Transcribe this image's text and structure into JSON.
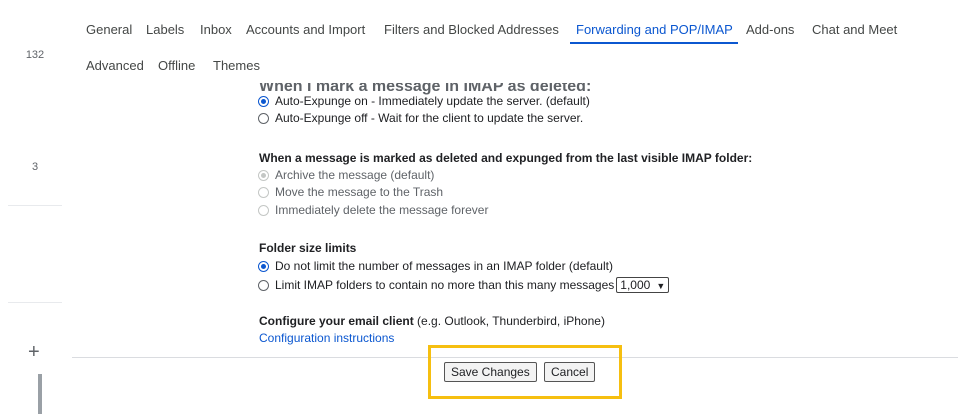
{
  "sidebar": {
    "counts": [
      "132",
      "3"
    ],
    "compose_plus": "+"
  },
  "tabs": [
    {
      "label": "General",
      "active": false
    },
    {
      "label": "Labels",
      "active": false
    },
    {
      "label": "Inbox",
      "active": false
    },
    {
      "label": "Accounts and Import",
      "active": false
    },
    {
      "label": "Filters and Blocked Addresses",
      "active": false
    },
    {
      "label": "Forwarding and POP/IMAP",
      "active": true
    },
    {
      "label": "Add-ons",
      "active": false
    },
    {
      "label": "Chat and Meet",
      "active": false
    },
    {
      "label": "Advanced",
      "active": false
    },
    {
      "label": "Offline",
      "active": false
    },
    {
      "label": "Themes",
      "active": false
    }
  ],
  "expunge": {
    "heading": "When I mark a message in IMAP as deleted:",
    "options": [
      {
        "label": "Auto-Expunge on - Immediately update the server. (default)",
        "selected": true,
        "disabled": false
      },
      {
        "label": "Auto-Expunge off - Wait for the client to update the server.",
        "selected": false,
        "disabled": false
      }
    ]
  },
  "deleted": {
    "heading": "When a message is marked as deleted and expunged from the last visible IMAP folder:",
    "options": [
      {
        "label": "Archive the message (default)",
        "selected": true,
        "disabled": true
      },
      {
        "label": "Move the message to the Trash",
        "selected": false,
        "disabled": true
      },
      {
        "label": "Immediately delete the message forever",
        "selected": false,
        "disabled": true
      }
    ]
  },
  "folder_limits": {
    "heading": "Folder size limits",
    "options": [
      {
        "label": "Do not limit the number of messages in an IMAP folder (default)",
        "selected": true
      },
      {
        "label": "Limit IMAP folders to contain no more than this many messages",
        "selected": false
      }
    ],
    "limit_value": "1,000"
  },
  "client": {
    "heading": "Configure your email client",
    "hint": "(e.g. Outlook, Thunderbird, iPhone)",
    "link": "Configuration instructions"
  },
  "actions": {
    "save": "Save Changes",
    "cancel": "Cancel"
  },
  "colors": {
    "accent": "#0b57d0",
    "highlight_frame": "#f6bf10"
  }
}
